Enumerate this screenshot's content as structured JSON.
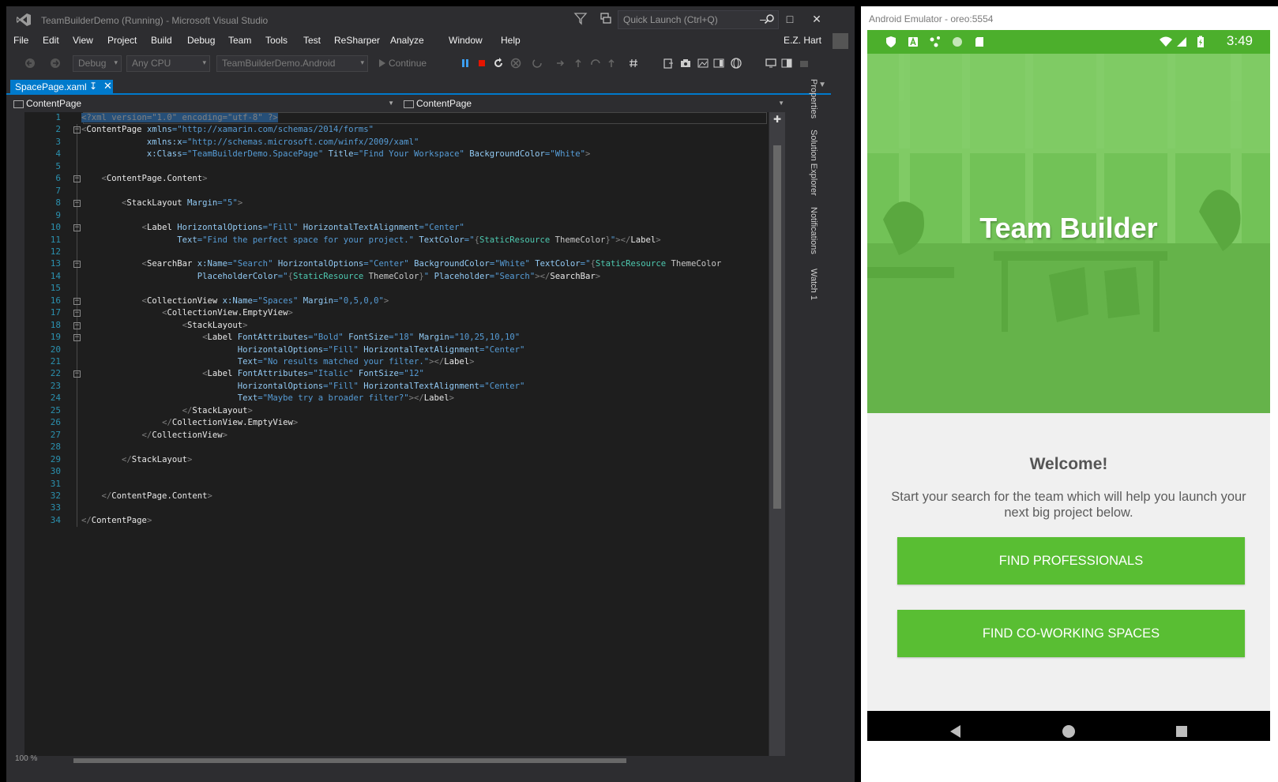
{
  "vs": {
    "title": "TeamBuilderDemo (Running) - Microsoft Visual Studio",
    "quick_launch_placeholder": "Quick Launch (Ctrl+Q)",
    "menu": [
      "File",
      "Edit",
      "View",
      "Project",
      "Build",
      "Debug",
      "Team",
      "Tools",
      "Test",
      "ReSharper",
      "Analyze",
      "Window",
      "Help"
    ],
    "user": "E.Z. Hart",
    "toolbar": {
      "config": "Debug",
      "platform": "Any CPU",
      "startup_project": "TeamBuilderDemo.Android",
      "continue_label": "Continue"
    },
    "tab": {
      "label": "SpacePage.xaml"
    },
    "nav": {
      "left": "ContentPage",
      "right": "ContentPage"
    },
    "zoom": "100 %",
    "side_tabs": [
      "Properties",
      "Solution Explorer",
      "Notifications",
      "Watch 1"
    ],
    "line_numbers": [
      "1",
      "2",
      "3",
      "4",
      "5",
      "6",
      "7",
      "8",
      "9",
      "10",
      "11",
      "12",
      "13",
      "14",
      "15",
      "16",
      "17",
      "18",
      "19",
      "20",
      "21",
      "22",
      "23",
      "24",
      "25",
      "26",
      "27",
      "28",
      "29",
      "30",
      "31",
      "32",
      "33",
      "34"
    ],
    "code_lines": [
      "<?xml version=\"1.0\" encoding=\"utf-8\" ?>",
      "<ContentPage xmlns=\"http://xamarin.com/schemas/2014/forms\"",
      "             xmlns:x=\"http://schemas.microsoft.com/winfx/2009/xaml\"",
      "             x:Class=\"TeamBuilderDemo.SpacePage\" Title=\"Find Your Workspace\" BackgroundColor=\"White\">",
      "",
      "    <ContentPage.Content>",
      "",
      "        <StackLayout Margin=\"5\">",
      "",
      "            <Label HorizontalOptions=\"Fill\" HorizontalTextAlignment=\"Center\"",
      "                   Text=\"Find the perfect space for your project.\" TextColor=\"{StaticResource ThemeColor}\"></Label>",
      "",
      "            <SearchBar x:Name=\"Search\" HorizontalOptions=\"Center\" BackgroundColor=\"White\" TextColor=\"{StaticResource ThemeColor}",
      "                       PlaceholderColor=\"{StaticResource ThemeColor}\" Placeholder=\"Search\"></SearchBar>",
      "",
      "            <CollectionView x:Name=\"Spaces\" Margin=\"0,5,0,0\">",
      "                <CollectionView.EmptyView>",
      "                    <StackLayout>",
      "                        <Label FontAttributes=\"Bold\" FontSize=\"18\" Margin=\"10,25,10,10\"",
      "                               HorizontalOptions=\"Fill\" HorizontalTextAlignment=\"Center\"",
      "                               Text=\"No results matched your filter.\"></Label>",
      "                        <Label FontAttributes=\"Italic\" FontSize=\"12\"",
      "                               HorizontalOptions=\"Fill\" HorizontalTextAlignment=\"Center\"",
      "                               Text=\"Maybe try a broader filter?\"></Label>",
      "                    </StackLayout>",
      "                </CollectionView.EmptyView>",
      "            </CollectionView>",
      "",
      "        </StackLayout>",
      "",
      "",
      "    </ContentPage.Content>",
      "",
      "</ContentPage>"
    ]
  },
  "emulator": {
    "title": "Android Emulator - oreo:5554",
    "time": "3:49",
    "hero_title": "Team Builder",
    "welcome": "Welcome!",
    "subtitle": "Start your search for the team which will help you launch your next big project below.",
    "btn_professionals": "FIND PROFESSIONALS",
    "btn_spaces": "FIND CO-WORKING SPACES"
  },
  "colors": {
    "vs_accent": "#007acc",
    "android_green": "#59be33",
    "status_bar_green": "#4caf2c"
  }
}
